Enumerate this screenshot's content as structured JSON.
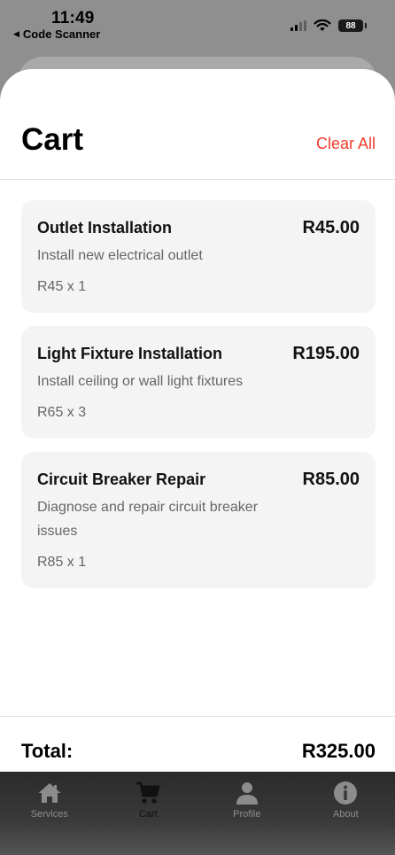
{
  "status_bar": {
    "time": "11:49",
    "back_app": "Code Scanner",
    "battery": "88"
  },
  "cart": {
    "title": "Cart",
    "clear_all": "Clear All",
    "items": [
      {
        "name": "Outlet Installation",
        "price": "R45.00",
        "description": "Install new electrical outlet",
        "quantity": "R45 x 1"
      },
      {
        "name": "Light Fixture Installation",
        "price": "R195.00",
        "description": "Install ceiling or wall light fixtures",
        "quantity": "R65 x 3"
      },
      {
        "name": "Circuit Breaker Repair",
        "price": "R85.00",
        "description": "Diagnose and repair circuit breaker issues",
        "quantity": "R85 x 1"
      }
    ],
    "total_label": "Total:",
    "total_value": "R325.00"
  },
  "tab_bar": {
    "tabs": [
      {
        "label": "Services",
        "icon": "home-icon",
        "active": false
      },
      {
        "label": "Cart",
        "icon": "cart-icon",
        "active": true
      },
      {
        "label": "Profile",
        "icon": "person-icon",
        "active": false
      },
      {
        "label": "About",
        "icon": "info-icon",
        "active": false
      }
    ]
  },
  "colors": {
    "accent_red": "#ef3b2c",
    "card_bg": "#f4f4f4"
  }
}
